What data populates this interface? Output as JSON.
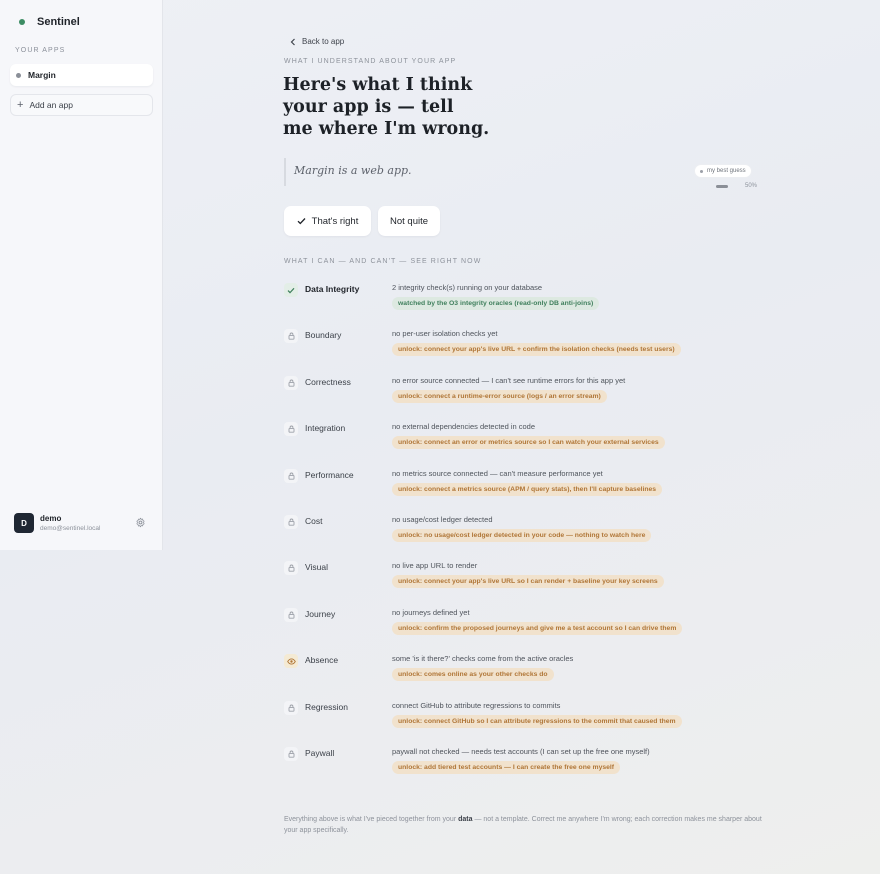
{
  "sidebar": {
    "brand": "Sentinel",
    "section_label": "YOUR APPS",
    "apps": [
      {
        "name": "Margin"
      }
    ],
    "add_app_label": "Add an app",
    "user": {
      "initial": "D",
      "name": "demo",
      "email": "demo@sentinel.local"
    }
  },
  "main": {
    "back_label": "Back to app",
    "eyebrow": "WHAT I UNDERSTAND ABOUT YOUR APP",
    "heading_lines": [
      "Here's what I think",
      "your app is — tell",
      "me where I'm wrong."
    ],
    "guess": "Margin is a web app.",
    "best_guess_label": "my best guess",
    "confidence": {
      "value": 50,
      "label": "50%"
    },
    "confirm_label": "That's right",
    "reject_label": "Not quite",
    "capabilities_label": "WHAT I CAN — AND CAN'T — SEE RIGHT NOW",
    "capabilities": [
      {
        "name": "Data Integrity",
        "icon": "check-icon",
        "description": "2 integrity check(s) running on your database",
        "status": "watch",
        "note": "watched by the O3 integrity oracles (read-only DB anti-joins)"
      },
      {
        "name": "Boundary",
        "icon": "lock-icon",
        "description": "no per-user isolation checks yet",
        "status": "unlock",
        "note": "unlock: connect your app's live URL + confirm the isolation checks (needs test users)"
      },
      {
        "name": "Correctness",
        "icon": "lock-icon",
        "description": "no error source connected — I can't see runtime errors for this app yet",
        "status": "unlock",
        "note": "unlock: connect a runtime-error source (logs / an error stream)"
      },
      {
        "name": "Integration",
        "icon": "lock-icon",
        "description": "no external dependencies detected in code",
        "status": "unlock",
        "note": "unlock: connect an error or metrics source so I can watch your external services"
      },
      {
        "name": "Performance",
        "icon": "lock-icon",
        "description": "no metrics source connected — can't measure performance yet",
        "status": "unlock",
        "note": "unlock: connect a metrics source (APM / query stats), then I'll capture baselines"
      },
      {
        "name": "Cost",
        "icon": "lock-icon",
        "description": "no usage/cost ledger detected",
        "status": "unlock",
        "note": "unlock: no usage/cost ledger detected in your code — nothing to watch here"
      },
      {
        "name": "Visual",
        "icon": "lock-icon",
        "description": "no live app URL to render",
        "status": "unlock",
        "note": "unlock: connect your app's live URL so I can render + baseline your key screens"
      },
      {
        "name": "Journey",
        "icon": "lock-icon",
        "description": "no journeys defined yet",
        "status": "unlock",
        "note": "unlock: confirm the proposed journeys and give me a test account so I can drive them"
      },
      {
        "name": "Absence",
        "icon": "eye-icon",
        "description": "some 'is it there?' checks come from the active oracles",
        "status": "unlock",
        "note": "unlock: comes online as your other checks do"
      },
      {
        "name": "Regression",
        "icon": "lock-icon",
        "description": "connect GitHub to attribute regressions to commits",
        "status": "unlock",
        "note": "unlock: connect GitHub so I can attribute regressions to the commit that caused them"
      },
      {
        "name": "Paywall",
        "icon": "lock-icon",
        "description": "paywall not checked — needs test accounts (I can set up the free one myself)",
        "status": "unlock",
        "note": "unlock: add tiered test accounts — I can create the free one myself"
      }
    ],
    "footer": {
      "before": "Everything above is what I've pieced together from your ",
      "emphasis": "data",
      "after": " — not a template. Correct me anywhere I'm wrong; each correction makes me sharper about your app specifically."
    }
  },
  "colors": {
    "accent_green": "#3c8c63",
    "unlock_bg": "#f1e2cd",
    "unlock_text": "#b07637",
    "watch_bg": "#dde9e1",
    "watch_text": "#3f7f5c"
  }
}
